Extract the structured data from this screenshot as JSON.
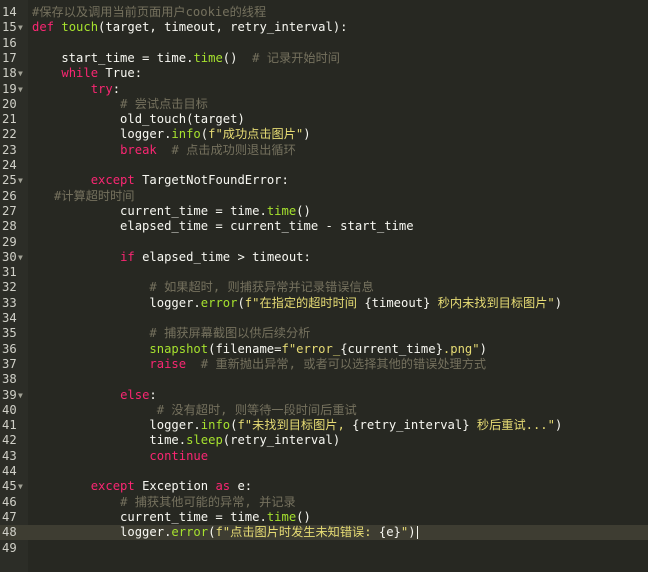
{
  "editor": {
    "lines": [
      {
        "n": "14",
        "fold": false,
        "tokens": [
          {
            "t": "cm",
            "v": "#保存以及调用当前页面用户cookie的线程"
          }
        ]
      },
      {
        "n": "15",
        "fold": true,
        "tokens": [
          {
            "t": "kw",
            "v": "def "
          },
          {
            "t": "fn",
            "v": "touch"
          },
          {
            "t": "pl",
            "v": "(target, timeout, retry_interval):"
          }
        ]
      },
      {
        "n": "16",
        "fold": false,
        "tokens": []
      },
      {
        "n": "17",
        "fold": false,
        "tokens": [
          {
            "t": "pl",
            "v": "    start_time = time."
          },
          {
            "t": "fn",
            "v": "time"
          },
          {
            "t": "pl",
            "v": "()  "
          },
          {
            "t": "cm",
            "v": "# 记录开始时间"
          }
        ]
      },
      {
        "n": "18",
        "fold": true,
        "tokens": [
          {
            "t": "pl",
            "v": "    "
          },
          {
            "t": "kw",
            "v": "while "
          },
          {
            "t": "pl",
            "v": "True:"
          }
        ]
      },
      {
        "n": "19",
        "fold": true,
        "tokens": [
          {
            "t": "pl",
            "v": "        "
          },
          {
            "t": "kw",
            "v": "try"
          },
          {
            "t": "pl",
            "v": ":"
          }
        ]
      },
      {
        "n": "20",
        "fold": false,
        "tokens": [
          {
            "t": "pl",
            "v": "            "
          },
          {
            "t": "cm",
            "v": "# 尝试点击目标"
          }
        ]
      },
      {
        "n": "21",
        "fold": false,
        "tokens": [
          {
            "t": "pl",
            "v": "            old_touch(target)"
          }
        ]
      },
      {
        "n": "22",
        "fold": false,
        "tokens": [
          {
            "t": "pl",
            "v": "            logger."
          },
          {
            "t": "fn",
            "v": "info"
          },
          {
            "t": "pl",
            "v": "("
          },
          {
            "t": "str",
            "v": "f\"成功点击图片\""
          },
          {
            "t": "pl",
            "v": ")"
          }
        ]
      },
      {
        "n": "23",
        "fold": false,
        "tokens": [
          {
            "t": "pl",
            "v": "            "
          },
          {
            "t": "kw",
            "v": "break  "
          },
          {
            "t": "cm",
            "v": "# 点击成功则退出循环"
          }
        ]
      },
      {
        "n": "24",
        "fold": false,
        "tokens": []
      },
      {
        "n": "25",
        "fold": true,
        "tokens": [
          {
            "t": "pl",
            "v": "        "
          },
          {
            "t": "kw",
            "v": "except "
          },
          {
            "t": "pl",
            "v": "TargetNotFoundError:"
          }
        ]
      },
      {
        "n": "26",
        "fold": false,
        "tokens": [
          {
            "t": "pl",
            "v": "   "
          },
          {
            "t": "cm",
            "v": "#计算超时时间"
          }
        ]
      },
      {
        "n": "27",
        "fold": false,
        "tokens": [
          {
            "t": "pl",
            "v": "            current_time = time."
          },
          {
            "t": "fn",
            "v": "time"
          },
          {
            "t": "pl",
            "v": "()"
          }
        ]
      },
      {
        "n": "28",
        "fold": false,
        "tokens": [
          {
            "t": "pl",
            "v": "            elapsed_time = current_time - start_time"
          }
        ]
      },
      {
        "n": "29",
        "fold": false,
        "tokens": []
      },
      {
        "n": "30",
        "fold": true,
        "tokens": [
          {
            "t": "pl",
            "v": "            "
          },
          {
            "t": "kw",
            "v": "if "
          },
          {
            "t": "pl",
            "v": "elapsed_time > timeout:"
          }
        ]
      },
      {
        "n": "31",
        "fold": false,
        "tokens": []
      },
      {
        "n": "32",
        "fold": false,
        "tokens": [
          {
            "t": "pl",
            "v": "                "
          },
          {
            "t": "cm",
            "v": "# 如果超时, 则捕获异常并记录错误信息"
          }
        ]
      },
      {
        "n": "33",
        "fold": false,
        "tokens": [
          {
            "t": "pl",
            "v": "                logger."
          },
          {
            "t": "fn",
            "v": "error"
          },
          {
            "t": "pl",
            "v": "("
          },
          {
            "t": "str",
            "v": "f\"在指定的超时时间 "
          },
          {
            "t": "pl",
            "v": "{timeout}"
          },
          {
            "t": "str",
            "v": " 秒内未找到目标图片\""
          },
          {
            "t": "pl",
            "v": ")"
          }
        ]
      },
      {
        "n": "34",
        "fold": false,
        "tokens": []
      },
      {
        "n": "35",
        "fold": false,
        "tokens": [
          {
            "t": "pl",
            "v": "                "
          },
          {
            "t": "cm",
            "v": "# 捕获屏幕截图以供后续分析"
          }
        ]
      },
      {
        "n": "36",
        "fold": false,
        "tokens": [
          {
            "t": "pl",
            "v": "                "
          },
          {
            "t": "fn",
            "v": "snapshot"
          },
          {
            "t": "pl",
            "v": "(filename="
          },
          {
            "t": "str",
            "v": "f\"error_"
          },
          {
            "t": "pl",
            "v": "{current_time}"
          },
          {
            "t": "str",
            "v": ".png\""
          },
          {
            "t": "pl",
            "v": ")"
          }
        ]
      },
      {
        "n": "37",
        "fold": false,
        "tokens": [
          {
            "t": "pl",
            "v": "                "
          },
          {
            "t": "kw",
            "v": "raise  "
          },
          {
            "t": "cm",
            "v": "# 重新抛出异常, 或者可以选择其他的错误处理方式"
          }
        ]
      },
      {
        "n": "38",
        "fold": false,
        "tokens": []
      },
      {
        "n": "39",
        "fold": true,
        "tokens": [
          {
            "t": "pl",
            "v": "            "
          },
          {
            "t": "kw",
            "v": "else"
          },
          {
            "t": "pl",
            "v": ":"
          }
        ]
      },
      {
        "n": "40",
        "fold": false,
        "tokens": [
          {
            "t": "pl",
            "v": "                 "
          },
          {
            "t": "cm",
            "v": "# 没有超时, 则等待一段时间后重试"
          }
        ]
      },
      {
        "n": "41",
        "fold": false,
        "tokens": [
          {
            "t": "pl",
            "v": "                logger."
          },
          {
            "t": "fn",
            "v": "info"
          },
          {
            "t": "pl",
            "v": "("
          },
          {
            "t": "str",
            "v": "f\"未找到目标图片, "
          },
          {
            "t": "pl",
            "v": "{retry_interval}"
          },
          {
            "t": "str",
            "v": " 秒后重试...\""
          },
          {
            "t": "pl",
            "v": ")"
          }
        ]
      },
      {
        "n": "42",
        "fold": false,
        "tokens": [
          {
            "t": "pl",
            "v": "                time."
          },
          {
            "t": "fn",
            "v": "sleep"
          },
          {
            "t": "pl",
            "v": "(retry_interval)"
          }
        ]
      },
      {
        "n": "43",
        "fold": false,
        "tokens": [
          {
            "t": "pl",
            "v": "                "
          },
          {
            "t": "kw",
            "v": "continue"
          }
        ]
      },
      {
        "n": "44",
        "fold": false,
        "tokens": []
      },
      {
        "n": "45",
        "fold": true,
        "tokens": [
          {
            "t": "pl",
            "v": "        "
          },
          {
            "t": "kw",
            "v": "except "
          },
          {
            "t": "pl",
            "v": "Exception "
          },
          {
            "t": "kw",
            "v": "as "
          },
          {
            "t": "pl",
            "v": "e:"
          }
        ]
      },
      {
        "n": "46",
        "fold": false,
        "tokens": [
          {
            "t": "pl",
            "v": "            "
          },
          {
            "t": "cm",
            "v": "# 捕获其他可能的异常, 并记录"
          }
        ]
      },
      {
        "n": "47",
        "fold": false,
        "tokens": [
          {
            "t": "pl",
            "v": "            current_time = time."
          },
          {
            "t": "fn",
            "v": "time"
          },
          {
            "t": "pl",
            "v": "()"
          }
        ]
      },
      {
        "n": "48",
        "fold": false,
        "current": true,
        "tokens": [
          {
            "t": "pl",
            "v": "            logger."
          },
          {
            "t": "fn",
            "v": "error"
          },
          {
            "t": "pl",
            "v": "("
          },
          {
            "t": "str",
            "v": "f\"点击图片时发生未知错误: "
          },
          {
            "t": "pl",
            "v": "{e}"
          },
          {
            "t": "str",
            "v": "\""
          },
          {
            "t": "pl",
            "v": ")"
          }
        ]
      },
      {
        "n": "49",
        "fold": false,
        "tokens": []
      }
    ]
  },
  "colors": {
    "background": "#272822",
    "current_line": "#3e3d32",
    "keyword": "#f92672",
    "function": "#a6e22e",
    "string": "#e6db74",
    "comment": "#75715e",
    "plain": "#f8f8f2"
  },
  "icons": {
    "fold_marker": "chevron-down-icon"
  }
}
